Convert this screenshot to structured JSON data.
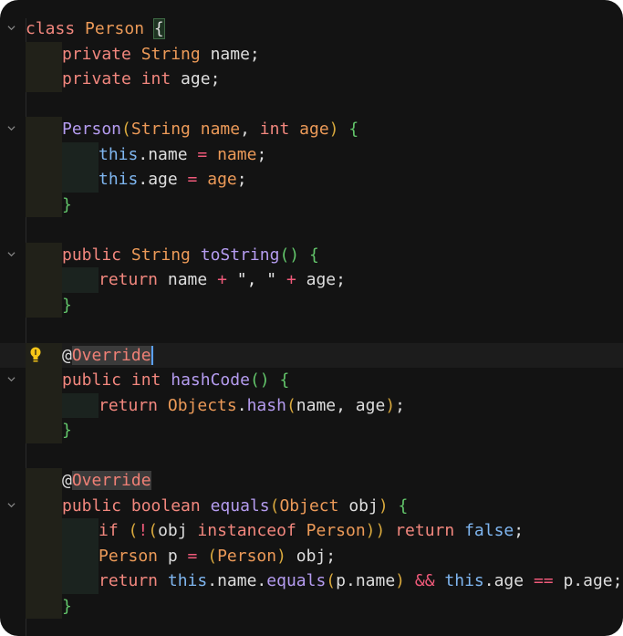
{
  "editor": {
    "lines": [
      {
        "fold": true,
        "indent": 0,
        "tokens": [
          [
            "kw",
            "class"
          ],
          [
            "pl",
            " "
          ],
          [
            "ty",
            "Person"
          ],
          [
            "pl",
            " "
          ],
          [
            "brc",
            "{"
          ]
        ]
      },
      {
        "fold": false,
        "indent": 1,
        "tokens": [
          [
            "kw",
            "private"
          ],
          [
            "pl",
            " "
          ],
          [
            "ty",
            "String"
          ],
          [
            "pl",
            " name;"
          ]
        ]
      },
      {
        "fold": false,
        "indent": 1,
        "tokens": [
          [
            "kw",
            "private"
          ],
          [
            "pl",
            " "
          ],
          [
            "kw",
            "int"
          ],
          [
            "pl",
            " age;"
          ]
        ]
      },
      {
        "fold": false,
        "indent": 0,
        "tokens": []
      },
      {
        "fold": true,
        "indent": 1,
        "tokens": [
          [
            "fn",
            "Person"
          ],
          [
            "br2",
            "("
          ],
          [
            "ty",
            "String"
          ],
          [
            "pl",
            " "
          ],
          [
            "ty",
            "name"
          ],
          [
            "pl",
            ", "
          ],
          [
            "kw",
            "int"
          ],
          [
            "pl",
            " "
          ],
          [
            "ty",
            "age"
          ],
          [
            "br2",
            ")"
          ],
          [
            "pl",
            " "
          ],
          [
            "br",
            "{"
          ]
        ]
      },
      {
        "fold": false,
        "indent": 2,
        "tokens": [
          [
            "th",
            "this"
          ],
          [
            "pl",
            ".name "
          ],
          [
            "op",
            "="
          ],
          [
            "pl",
            " "
          ],
          [
            "ty",
            "name"
          ],
          [
            "pl",
            ";"
          ]
        ]
      },
      {
        "fold": false,
        "indent": 2,
        "tokens": [
          [
            "th",
            "this"
          ],
          [
            "pl",
            ".age "
          ],
          [
            "op",
            "="
          ],
          [
            "pl",
            " "
          ],
          [
            "ty",
            "age"
          ],
          [
            "pl",
            ";"
          ]
        ]
      },
      {
        "fold": false,
        "indent": 1,
        "tokens": [
          [
            "br",
            "}"
          ]
        ]
      },
      {
        "fold": false,
        "indent": 0,
        "tokens": []
      },
      {
        "fold": true,
        "indent": 1,
        "tokens": [
          [
            "kw",
            "public"
          ],
          [
            "pl",
            " "
          ],
          [
            "ty",
            "String"
          ],
          [
            "pl",
            " "
          ],
          [
            "fn",
            "toString"
          ],
          [
            "br",
            "()"
          ],
          [
            "pl",
            " "
          ],
          [
            "br",
            "{"
          ]
        ]
      },
      {
        "fold": false,
        "indent": 2,
        "tokens": [
          [
            "kw",
            "return"
          ],
          [
            "pl",
            " name "
          ],
          [
            "op",
            "+"
          ],
          [
            "pl",
            " "
          ],
          [
            "st",
            "\", \""
          ],
          [
            "pl",
            " "
          ],
          [
            "op",
            "+"
          ],
          [
            "pl",
            " age;"
          ]
        ]
      },
      {
        "fold": false,
        "indent": 1,
        "tokens": [
          [
            "br",
            "}"
          ]
        ]
      },
      {
        "fold": false,
        "indent": 0,
        "tokens": []
      },
      {
        "fold": false,
        "indent": 1,
        "bulb": true,
        "highlight": true,
        "tokens": [
          [
            "pl",
            "@"
          ],
          [
            "anno",
            "Override"
          ],
          [
            "cur",
            ""
          ]
        ]
      },
      {
        "fold": true,
        "indent": 1,
        "tokens": [
          [
            "kw",
            "public"
          ],
          [
            "pl",
            " "
          ],
          [
            "kw",
            "int"
          ],
          [
            "pl",
            " "
          ],
          [
            "fn",
            "hashCode"
          ],
          [
            "br",
            "()"
          ],
          [
            "pl",
            " "
          ],
          [
            "br",
            "{"
          ]
        ]
      },
      {
        "fold": false,
        "indent": 2,
        "tokens": [
          [
            "kw",
            "return"
          ],
          [
            "pl",
            " "
          ],
          [
            "ty",
            "Objects"
          ],
          [
            "pl",
            "."
          ],
          [
            "fn",
            "hash"
          ],
          [
            "br2",
            "("
          ],
          [
            "pl",
            "name, age"
          ],
          [
            "br2",
            ")"
          ],
          [
            "pl",
            ";"
          ]
        ]
      },
      {
        "fold": false,
        "indent": 1,
        "tokens": [
          [
            "br",
            "}"
          ]
        ]
      },
      {
        "fold": false,
        "indent": 0,
        "tokens": []
      },
      {
        "fold": false,
        "indent": 1,
        "tokens": [
          [
            "pl",
            "@"
          ],
          [
            "anno",
            "Override"
          ]
        ]
      },
      {
        "fold": true,
        "indent": 1,
        "tokens": [
          [
            "kw",
            "public"
          ],
          [
            "pl",
            " "
          ],
          [
            "kw",
            "boolean"
          ],
          [
            "pl",
            " "
          ],
          [
            "fn",
            "equals"
          ],
          [
            "br2",
            "("
          ],
          [
            "ty",
            "Object"
          ],
          [
            "pl",
            " obj"
          ],
          [
            "br2",
            ")"
          ],
          [
            "pl",
            " "
          ],
          [
            "br",
            "{"
          ]
        ]
      },
      {
        "fold": false,
        "indent": 2,
        "tokens": [
          [
            "kw",
            "if"
          ],
          [
            "pl",
            " "
          ],
          [
            "br2",
            "("
          ],
          [
            "op",
            "!"
          ],
          [
            "br2",
            "("
          ],
          [
            "pl",
            "obj "
          ],
          [
            "kw",
            "instanceof"
          ],
          [
            "pl",
            " "
          ],
          [
            "ty",
            "Person"
          ],
          [
            "br2",
            "))"
          ],
          [
            "pl",
            " "
          ],
          [
            "kw",
            "return"
          ],
          [
            "pl",
            " "
          ],
          [
            "th",
            "false"
          ],
          [
            "pl",
            ";"
          ]
        ]
      },
      {
        "fold": false,
        "indent": 2,
        "tokens": [
          [
            "ty",
            "Person"
          ],
          [
            "pl",
            " p "
          ],
          [
            "op",
            "="
          ],
          [
            "pl",
            " "
          ],
          [
            "br2",
            "("
          ],
          [
            "ty",
            "Person"
          ],
          [
            "br2",
            ")"
          ],
          [
            "pl",
            " obj;"
          ]
        ]
      },
      {
        "fold": false,
        "indent": 2,
        "tokens": [
          [
            "kw",
            "return"
          ],
          [
            "pl",
            " "
          ],
          [
            "th",
            "this"
          ],
          [
            "pl",
            ".name."
          ],
          [
            "fn",
            "equals"
          ],
          [
            "br2",
            "("
          ],
          [
            "pl",
            "p.name"
          ],
          [
            "br2",
            ")"
          ],
          [
            "pl",
            " "
          ],
          [
            "op",
            "&&"
          ],
          [
            "pl",
            " "
          ],
          [
            "th",
            "this"
          ],
          [
            "pl",
            ".age "
          ],
          [
            "op",
            "=="
          ],
          [
            "pl",
            " p.age;"
          ]
        ]
      },
      {
        "fold": false,
        "indent": 1,
        "tokens": [
          [
            "br",
            "}"
          ]
        ]
      }
    ]
  }
}
